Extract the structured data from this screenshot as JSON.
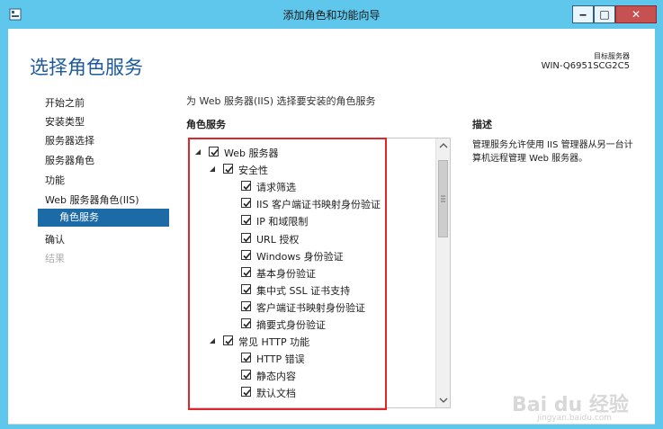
{
  "window": {
    "title": "添加角色和功能向导",
    "controls": {
      "minimize": "‒",
      "maximize": "□",
      "close": "✕"
    }
  },
  "page": {
    "heading": "选择角色服务",
    "destination_label": "目标服务器",
    "destination_server": "WIN-Q6951SCG2C5",
    "instruction": "为 Web 服务器(IIS) 选择要安装的角色服务",
    "services_header": "角色服务",
    "description_header": "描述",
    "description_text": "管理服务允许使用 IIS 管理器从另一台计算机远程管理 Web 服务器。"
  },
  "nav": {
    "items": [
      {
        "label": "开始之前",
        "state": "normal"
      },
      {
        "label": "安装类型",
        "state": "normal"
      },
      {
        "label": "服务器选择",
        "state": "normal"
      },
      {
        "label": "服务器角色",
        "state": "normal"
      },
      {
        "label": "功能",
        "state": "normal"
      },
      {
        "label": "Web 服务器角色(IIS)",
        "state": "normal"
      },
      {
        "label": "角色服务",
        "state": "active"
      },
      {
        "label": "确认",
        "state": "normal"
      },
      {
        "label": "结果",
        "state": "disabled"
      }
    ]
  },
  "tree": {
    "rows": [
      {
        "label": "Web 服务器",
        "level": 0,
        "expandable": true,
        "checked": true
      },
      {
        "label": "安全性",
        "level": 1,
        "expandable": true,
        "checked": true
      },
      {
        "label": "请求筛选",
        "level": 2,
        "expandable": false,
        "checked": true
      },
      {
        "label": "IIS 客户端证书映射身份验证",
        "level": 2,
        "expandable": false,
        "checked": true
      },
      {
        "label": "IP 和域限制",
        "level": 2,
        "expandable": false,
        "checked": true
      },
      {
        "label": "URL 授权",
        "level": 2,
        "expandable": false,
        "checked": true
      },
      {
        "label": "Windows 身份验证",
        "level": 2,
        "expandable": false,
        "checked": true
      },
      {
        "label": "基本身份验证",
        "level": 2,
        "expandable": false,
        "checked": true
      },
      {
        "label": "集中式 SSL 证书支持",
        "level": 2,
        "expandable": false,
        "checked": true
      },
      {
        "label": "客户端证书映射身份验证",
        "level": 2,
        "expandable": false,
        "checked": true
      },
      {
        "label": "摘要式身份验证",
        "level": 2,
        "expandable": false,
        "checked": true
      },
      {
        "label": "常见 HTTP 功能",
        "level": 1,
        "expandable": true,
        "checked": true
      },
      {
        "label": "HTTP 错误",
        "level": 2,
        "expandable": false,
        "checked": true
      },
      {
        "label": "静态内容",
        "level": 2,
        "expandable": false,
        "checked": true
      },
      {
        "label": "默认文档",
        "level": 2,
        "expandable": false,
        "checked": true
      }
    ]
  },
  "watermark": {
    "text": "Bai du 经验",
    "sub": "jingyan.baidu.com"
  },
  "colors": {
    "titlebar": "#5fc6ec",
    "heading": "#1c5a9c",
    "nav_active": "#1c6aa6",
    "highlight_box": "#e0252b",
    "close_button": "#c75050"
  }
}
